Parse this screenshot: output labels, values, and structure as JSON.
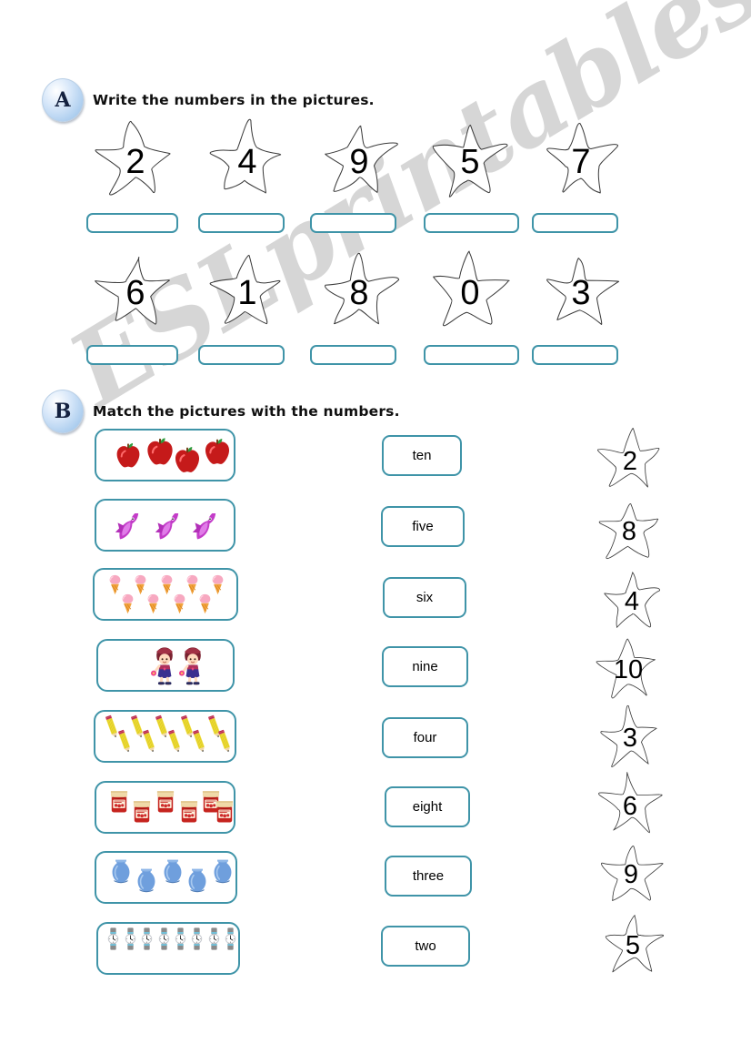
{
  "watermark": {
    "text": "ESLprintables.com"
  },
  "sections": [
    {
      "badge": "A",
      "title": "Write the numbers in the pictures.",
      "rows": [
        {
          "stars": [
            "2",
            "4",
            "9",
            "5",
            "7"
          ]
        },
        {
          "stars": [
            "6",
            "1",
            "8",
            "0",
            "3"
          ]
        }
      ]
    },
    {
      "badge": "B",
      "title": "Match the pictures with the numbers.",
      "pictures": [
        {
          "item": "apple",
          "count": 4,
          "icon": "apple-icon"
        },
        {
          "item": "fish",
          "count": 3,
          "icon": "fish-icon"
        },
        {
          "item": "ice cream",
          "count": 9,
          "icon": "ice-cream-icon"
        },
        {
          "item": "girl",
          "count": 2,
          "icon": "girl-icon"
        },
        {
          "item": "pencil",
          "count": 10,
          "icon": "pencil-icon"
        },
        {
          "item": "jam jar",
          "count": 6,
          "icon": "jam-jar-icon"
        },
        {
          "item": "vase",
          "count": 5,
          "icon": "vase-icon"
        },
        {
          "item": "watch",
          "count": 8,
          "icon": "watch-icon"
        }
      ],
      "words": [
        "ten",
        "five",
        "six",
        "nine",
        "four",
        "eight",
        "three",
        "two"
      ],
      "number_stars": [
        "2",
        "8",
        "4",
        "10",
        "3",
        "6",
        "9",
        "5"
      ]
    }
  ],
  "colors": {
    "box_border": "#3f94a8",
    "badge_fill": "#aaccee",
    "badge_text": "#14213f",
    "star_outline": "#3a3a3a",
    "watermark": "#cfcfcf",
    "apple": "#c51a1a",
    "fish": "#c33cc8",
    "ice_cream": "#f7a8c0",
    "pencil": "#f2e03a",
    "jam": "#c6241f",
    "vase": "#6f9fdd",
    "watch": "#8a8a8a"
  }
}
